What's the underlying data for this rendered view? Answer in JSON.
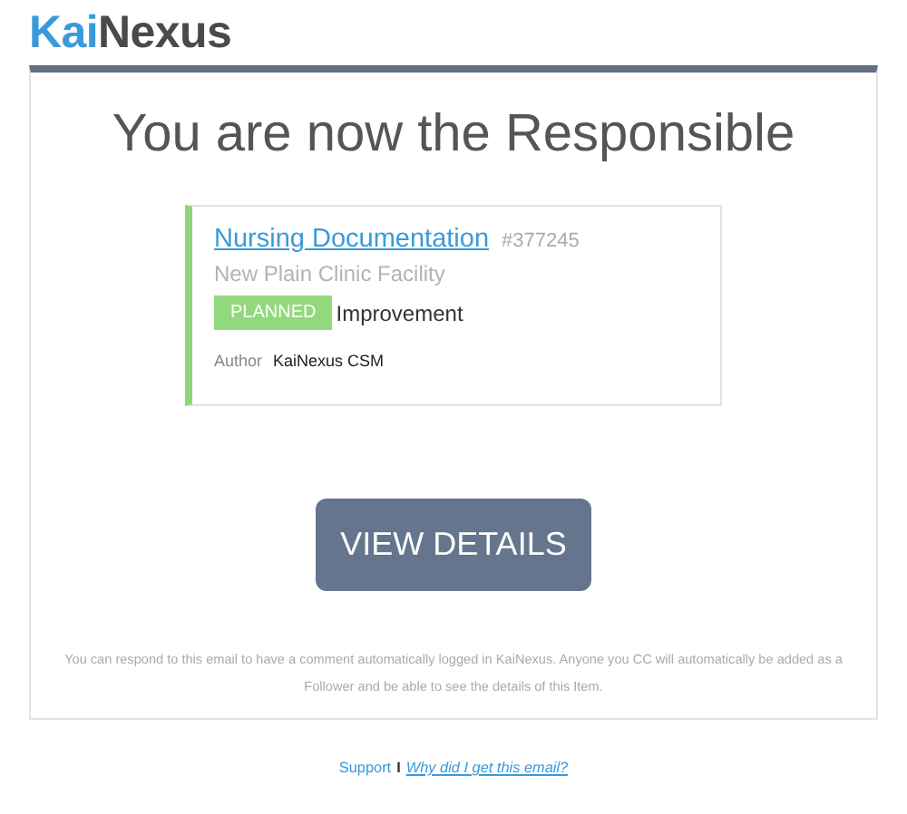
{
  "logo": {
    "first": "Kai",
    "second": "Nexus"
  },
  "heading": "You are now the Responsible",
  "item": {
    "title": "Nursing Documentation",
    "number": "#377245",
    "location": "New Plain Clinic Facility",
    "status": "PLANNED",
    "type": "Improvement",
    "author_label": "Author",
    "author": "KaiNexus CSM"
  },
  "button": "VIEW DETAILS",
  "note": "You can respond to this email to have a comment automatically logged in KaiNexus. Anyone you CC will automatically be added as a Follower and be able to see the details of this Item.",
  "footer": {
    "support": "Support",
    "separator": "I",
    "why": "Why did I get this email?"
  }
}
